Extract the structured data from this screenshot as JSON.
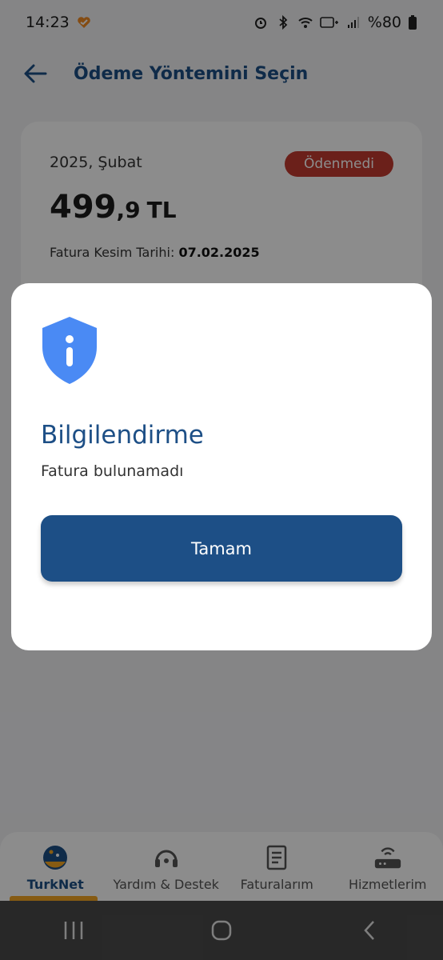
{
  "status_bar": {
    "time": "14:23",
    "battery_text": "%80"
  },
  "header": {
    "title": "Ödeme Yöntemini Seçin"
  },
  "bill": {
    "period": "2025, Şubat",
    "status": "Ödenmedi",
    "amount_int": "499",
    "amount_dec": ",9",
    "currency": "TL",
    "date_label": "Fatura Kesim Tarihi:",
    "date_value": "07.02.2025"
  },
  "dialog": {
    "title": "Bilgilendirme",
    "message": "Fatura bulunamadı",
    "button_label": "Tamam"
  },
  "bottom_nav": {
    "items": [
      {
        "label": "TurkNet",
        "icon": "turknet-logo-icon",
        "active": true
      },
      {
        "label": "Yardım & Destek",
        "icon": "headset-icon",
        "active": false
      },
      {
        "label": "Faturalarım",
        "icon": "invoice-icon",
        "active": false
      },
      {
        "label": "Hizmetlerim",
        "icon": "router-icon",
        "active": false
      }
    ]
  },
  "colors": {
    "primary": "#1d4f86",
    "badge_red": "#c43b30",
    "accent_orange": "#f5a623",
    "shield_blue": "#4a8af4"
  }
}
